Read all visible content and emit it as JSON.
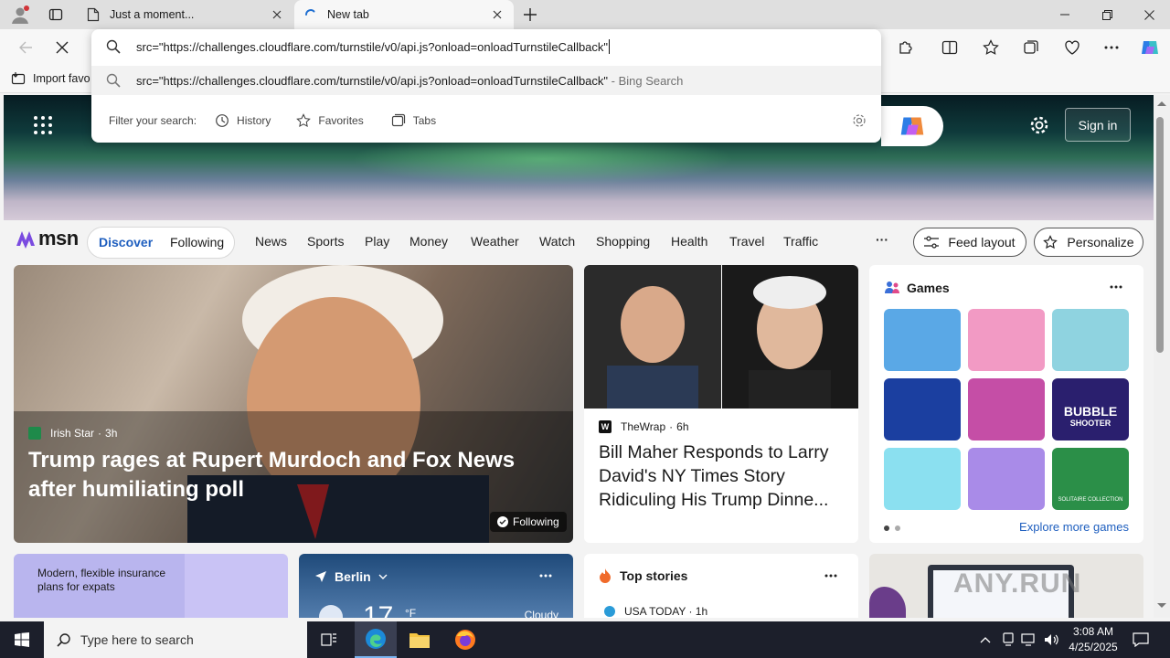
{
  "tabs": [
    {
      "title": "Just a moment...",
      "icon": "page-icon"
    },
    {
      "title": "New tab",
      "icon": "loading-spinner-icon"
    }
  ],
  "omnibox": {
    "input": "src=\"https://challenges.cloudflare.com/turnstile/v0/api.js?onload=onloadTurnstileCallback\"",
    "suggestion": "src=\"https://challenges.cloudflare.com/turnstile/v0/api.js?onload=onloadTurnstileCallback\"",
    "suggestion_suffix": " - Bing Search",
    "filter_label": "Filter your search:",
    "filters": [
      "History",
      "Favorites",
      "Tabs"
    ]
  },
  "favorites_bar": {
    "import_label": "Import favo"
  },
  "msn": {
    "logo": "msn",
    "sign_in": "Sign in",
    "pills": [
      "Discover",
      "Following"
    ],
    "nav": [
      "News",
      "Sports",
      "Play",
      "Money",
      "Weather",
      "Watch",
      "Shopping",
      "Health",
      "Travel",
      "Traffic"
    ],
    "more": "···",
    "feed_layout": "Feed layout",
    "personalize": "Personalize"
  },
  "main_story": {
    "source": "Irish Star",
    "age": "3h",
    "title": "Trump rages at Rupert Murdoch and Fox News after humiliating poll",
    "following": "Following"
  },
  "side_story": {
    "source": "TheWrap",
    "age": "6h",
    "title": "Bill Maher Responds to Larry David's NY Times Story Ridiculing His Trump Dinne..."
  },
  "games": {
    "title": "Games",
    "explore": "Explore more games",
    "tile_colors": [
      "#5aa8e6",
      "#f29ac4",
      "#8fd3e0",
      "#1b3fa0",
      "#c54ea6",
      "#2a1f6e",
      "#8be0f0",
      "#a98be8",
      "#2b8f48"
    ],
    "bubble_text": "BUBBLE",
    "bubble_sub": "SHOOTER",
    "solitaire_text": "SOLITAIRE COLLECTION"
  },
  "promo": {
    "text": "Modern, flexible insurance plans for expats"
  },
  "weather": {
    "city": "Berlin",
    "temp": "17",
    "unit": "°F",
    "condition": "Cloudy"
  },
  "top_stories": {
    "title": "Top stories",
    "first_source": "USA TODAY · 1h"
  },
  "watermark": "ANY.RUN",
  "taskbar": {
    "search_placeholder": "Type here to search",
    "time": "3:08 AM",
    "date": "4/25/2025"
  }
}
